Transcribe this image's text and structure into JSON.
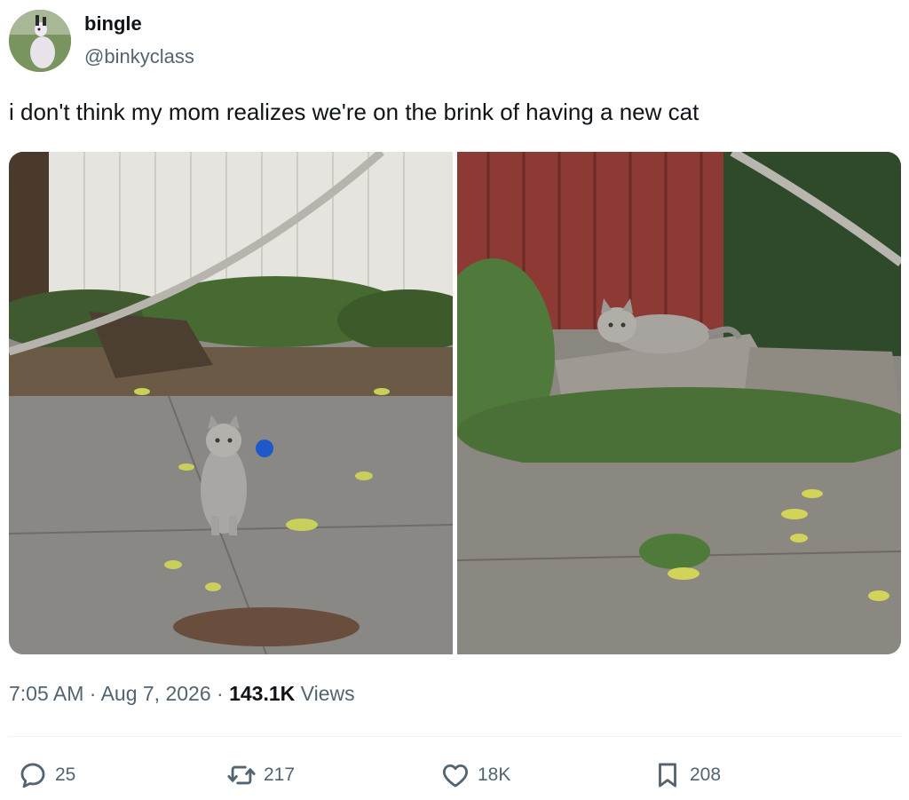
{
  "author": {
    "name": "bingle",
    "handle": "@binkyclass"
  },
  "tweet": {
    "text": "i don't think my mom realizes we're on the brink of having a new cat"
  },
  "media": [
    {
      "alt": ""
    },
    {
      "alt": ""
    }
  ],
  "meta": {
    "time": "7:05 AM",
    "sep1": "·",
    "date": "Aug 7, 2026",
    "sep2": "·",
    "views": "143.1K",
    "views_label": "Views"
  },
  "actions": {
    "replies": "25",
    "reposts": "217",
    "likes": "18K",
    "bookmarks": "208"
  },
  "icons": {
    "reply": "speech-bubble-icon",
    "repost": "repost-arrows-icon",
    "like": "heart-icon",
    "bookmark": "bookmark-icon"
  },
  "colors": {
    "text_primary": "#0f1419",
    "text_secondary": "#536471",
    "divider": "#eff3f4"
  }
}
